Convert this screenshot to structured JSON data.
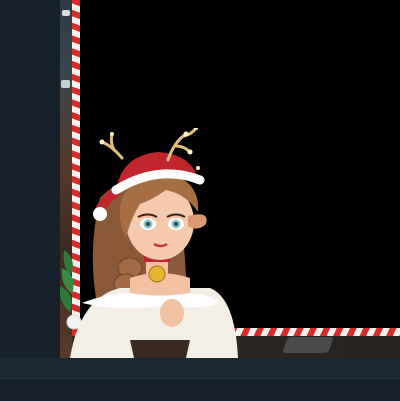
{
  "stream": {
    "overlay_theme": "candy-cane-border",
    "avatar": "reindeer-santa-girl-avatar",
    "border_colors": [
      "#d72b2b",
      "#f4f1ec"
    ]
  },
  "icons": [
    "holly-icon",
    "antler-lights-icon",
    "bell-icon"
  ],
  "colors": {
    "sidebar": "#16212b",
    "video_background": "#000000",
    "bottom_bar": "#1b2731",
    "accent_red": "#d72b2b"
  }
}
